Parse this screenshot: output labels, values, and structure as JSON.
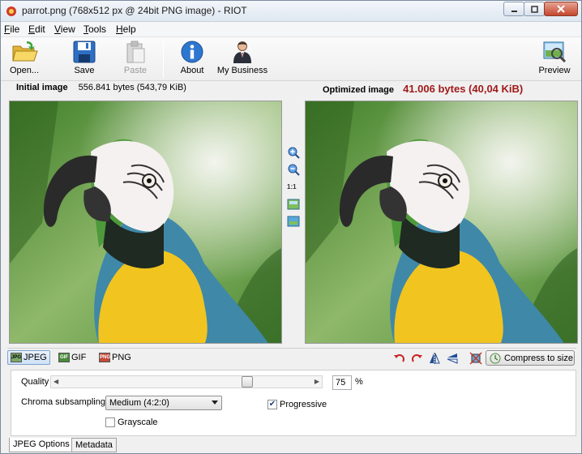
{
  "window": {
    "title": "parrot.png (768x512 px @ 24bit PNG image) - RIOT"
  },
  "menu": {
    "items": [
      {
        "label": "File",
        "underline": "F",
        "rest": "ile"
      },
      {
        "label": "Edit",
        "underline": "E",
        "rest": "dit"
      },
      {
        "label": "View",
        "underline": "V",
        "rest": "iew"
      },
      {
        "label": "Tools",
        "underline": "T",
        "rest": "ools"
      },
      {
        "label": "Help",
        "underline": "H",
        "rest": "elp"
      }
    ]
  },
  "toolbar": {
    "open_label": "Open...",
    "save_label": "Save",
    "paste_label": "Paste",
    "about_label": "About",
    "business_label": "My Business",
    "preview_label": "Preview"
  },
  "initial": {
    "label": "Initial image",
    "size": "556.841 bytes (543,79 KiB)"
  },
  "optimized": {
    "label": "Optimized image",
    "size": "41.006 bytes (40,04 KiB)"
  },
  "zoom": {
    "one_to_one": "1:1"
  },
  "formats": {
    "jpeg": "JPEG",
    "gif": "GIF",
    "png": "PNG",
    "jpeg_icon": "JPG",
    "gif_icon": "GIF",
    "png_icon": "PNG",
    "compress_label": "Compress to size"
  },
  "options": {
    "quality_label": "Quality",
    "quality_value": "75",
    "quality_fraction": 0.75,
    "quality_unit": "%",
    "chroma_label": "Chroma subsampling",
    "chroma_value": "Medium (4:2:0)",
    "progressive_label": "Progressive",
    "progressive_checked": true,
    "grayscale_label": "Grayscale",
    "grayscale_checked": false
  },
  "bottom_tabs": {
    "jpeg_options": "JPEG Options",
    "metadata": "Metadata"
  },
  "colors": {
    "optimized_size": "#a01a1a",
    "active_tab": "#cfe1f7"
  }
}
